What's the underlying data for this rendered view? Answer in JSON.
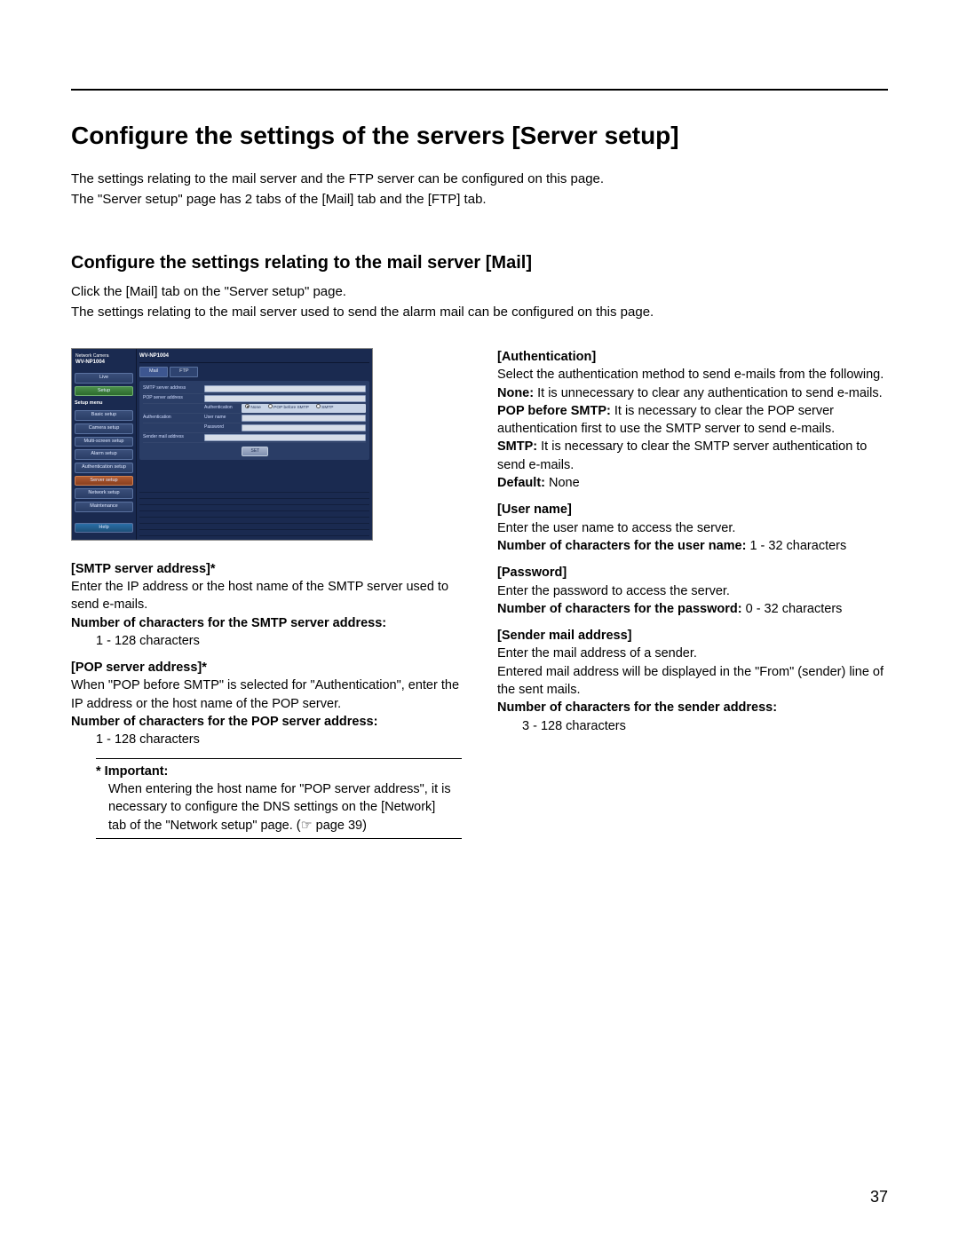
{
  "page_number": "37",
  "title": "Configure the settings of the servers [Server setup]",
  "intro": [
    "The settings relating to the mail server and the FTP server can be configured on this page.",
    "The \"Server setup\" page has 2 tabs of the [Mail] tab and the [FTP] tab."
  ],
  "subtitle": "Configure the settings relating to the mail server [Mail]",
  "sub_intro": [
    "Click the [Mail] tab on the \"Server setup\" page.",
    "The settings relating to the mail server used to send the alarm mail can be configured on this page."
  ],
  "ui": {
    "brand_line1": "Network Camera",
    "brand_line2": "WV-NP1004",
    "model": "WV-NP1004",
    "live": "Live",
    "setup": "Setup",
    "menu_heading": "Setup menu",
    "menu": {
      "basic": "Basic setup",
      "camera": "Camera setup",
      "multi": "Multi-screen setup",
      "alarm": "Alarm setup",
      "auth": "Authentication setup",
      "server": "Server setup",
      "network": "Network setup",
      "maint": "Maintenance"
    },
    "help": "Help",
    "tabs": {
      "mail": "Mail",
      "ftp": "FTP"
    },
    "rows": {
      "smtp": "SMTP server address",
      "pop": "POP server address",
      "auth": "Authentication",
      "authgroup": "Authentication",
      "user": "User name",
      "pass": "Password",
      "sender": "Sender mail address"
    },
    "radios": {
      "none": "None",
      "pop": "POP before SMTP",
      "smtp": "SMTP"
    },
    "set": "SET"
  },
  "left": {
    "smtp_title": "[SMTP server address]*",
    "smtp_body": "Enter the IP address or the host name of the SMTP server used to send e-mails.",
    "smtp_chars_label": "Number of characters for the SMTP server address:",
    "smtp_chars_value": "1 - 128 characters",
    "pop_title": "[POP server address]*",
    "pop_body": "When \"POP before SMTP\" is selected for \"Authentication\", enter the IP address or the host name of the POP server.",
    "pop_chars_label": "Number of characters for the POP server address:",
    "pop_chars_value": "1 - 128 characters",
    "important_title": "* Important:",
    "important_body": "When entering the host name for \"POP server address\", it is necessary to configure the DNS settings on the [Network] tab of the \"Network setup\" page. (☞ page 39)"
  },
  "right": {
    "auth_title": "[Authentication]",
    "auth_body": "Select the authentication method to send e-mails from the following.",
    "none_label": "None:",
    "none_body": " It is unnecessary to clear any authentication to send e-mails.",
    "popb_label": "POP before SMTP:",
    "popb_body": " It is necessary to clear the POP server authentication first to use the SMTP server to send e-mails.",
    "smtp_label": "SMTP:",
    "smtp_body": " It is necessary to clear the SMTP server authentication to send e-mails.",
    "default_label": "Default:",
    "default_value": " None",
    "user_title": "[User name]",
    "user_body": "Enter the user name to access the server.",
    "user_chars_label": "Number of characters for the user name:",
    "user_chars_value": " 1 - 32 characters",
    "pass_title": "[Password]",
    "pass_body": "Enter the password to access the server.",
    "pass_chars_label": "Number of characters for the password:",
    "pass_chars_value": " 0 - 32 characters",
    "sender_title": "[Sender mail address]",
    "sender_body1": "Enter the mail address of a sender.",
    "sender_body2": "Entered mail address will be displayed in the \"From\" (sender) line of the sent mails.",
    "sender_chars_label": "Number of characters for the sender address:",
    "sender_chars_value": "3 - 128 characters"
  }
}
